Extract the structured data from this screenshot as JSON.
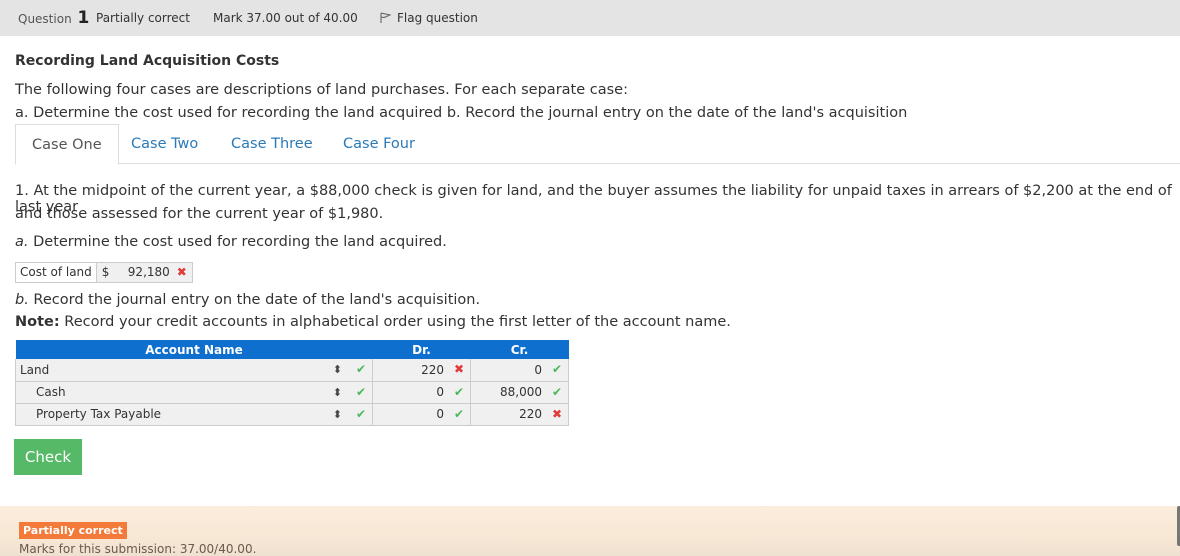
{
  "header": {
    "question_label": "Question",
    "question_number": "1",
    "state": "Partially correct",
    "mark": "Mark 37.00 out of 40.00",
    "flag_label": "Flag question",
    "flag_icon": "flag-icon"
  },
  "title": "Recording Land Acquisition Costs",
  "intro": {
    "line1": "The following four cases are descriptions of land purchases. For each separate case:",
    "line2": "a. Determine the cost used for recording the land acquired b. Record the journal entry on the date of the land's acquisition"
  },
  "tabs": [
    {
      "label": "Case One",
      "active": true
    },
    {
      "label": "Case Two",
      "active": false
    },
    {
      "label": "Case Three",
      "active": false
    },
    {
      "label": "Case Four",
      "active": false
    }
  ],
  "case": {
    "text_line1": "1. At the midpoint of the current year, a $88,000 check is given for land, and the buyer assumes the liability for unpaid taxes in arrears of $2,200 at the end of last year",
    "text_line2": "and those assessed for the current year of $1,980.",
    "part_a_letter": "a.",
    "part_a_text": " Determine the cost used for recording the land acquired.",
    "cost_label": "Cost of land",
    "cost_currency": "$",
    "cost_value": "92,180",
    "cost_status": "incorrect",
    "part_b_letter": "b.",
    "part_b_text": " Record the journal entry on the date of the land's acquisition.",
    "note_label": "Note:",
    "note_text": " Record your credit accounts in alphabetical order using the first letter of the account name."
  },
  "journal": {
    "headers": {
      "account": "Account Name",
      "dr": "Dr.",
      "cr": "Cr."
    },
    "rows": [
      {
        "account": "Land",
        "account_status": "correct",
        "dr": "220",
        "dr_status": "incorrect",
        "cr": "0",
        "cr_status": "correct"
      },
      {
        "account": "Cash",
        "account_status": "correct",
        "dr": "0",
        "dr_status": "correct",
        "cr": "88,000",
        "cr_status": "correct"
      },
      {
        "account": "Property Tax Payable",
        "account_status": "correct",
        "dr": "0",
        "dr_status": "correct",
        "cr": "220",
        "cr_status": "incorrect"
      }
    ]
  },
  "check_button": "Check",
  "feedback": {
    "badge": "Partially correct",
    "marks": "Marks for this submission: 37.00/40.00."
  },
  "icons": {
    "correct": "✔",
    "incorrect": "✖",
    "sort": "⬍"
  },
  "colors": {
    "header_blue": "#0f6fce",
    "check_green": "#56b968",
    "correct": "#4cb85c",
    "incorrect": "#e03b3b",
    "badge_orange": "#f47a39",
    "link_blue": "#2a7ab8"
  }
}
